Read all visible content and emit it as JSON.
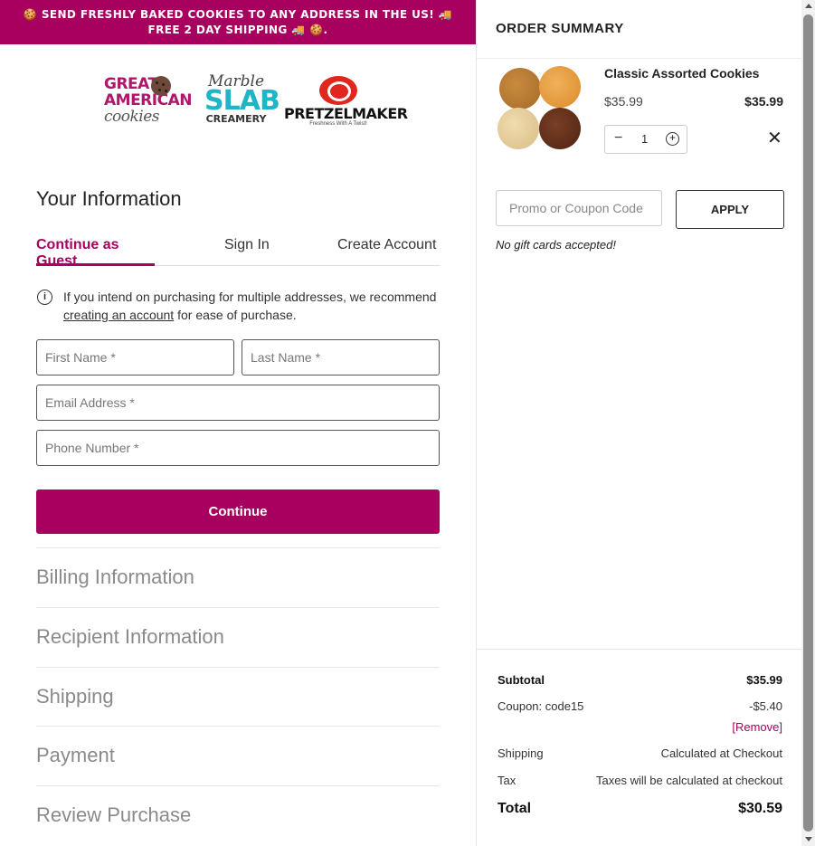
{
  "banner": {
    "text": "🍪 Send freshly baked cookies to any address in the US! 🚚 Free 2 day shipping 🚚 🍪."
  },
  "brands": {
    "gac": {
      "line1": "GREAT",
      "line2": "AMERICAN",
      "line3": "cookies"
    },
    "msc": {
      "line1": "Marble",
      "line2": "SLAB",
      "line3": "CREAMERY"
    },
    "pm": {
      "line1": "PRETZELMAKER",
      "tagline": "Freshness With A Twist!"
    }
  },
  "your_info": {
    "title": "Your Information",
    "tabs": [
      {
        "label": "Continue as Guest",
        "active": true
      },
      {
        "label": "Sign In",
        "active": false
      },
      {
        "label": "Create Account",
        "active": false
      }
    ],
    "note_before": "If you intend on purchasing for multiple addresses, we recommend ",
    "note_link": "creating an account",
    "note_after": " for ease of purchase.",
    "fields": {
      "first_name": {
        "placeholder": "First Name *",
        "value": ""
      },
      "last_name": {
        "placeholder": "Last Name *",
        "value": ""
      },
      "email": {
        "placeholder": "Email Address *",
        "value": ""
      },
      "phone": {
        "placeholder": "Phone Number *",
        "value": ""
      }
    },
    "continue_label": "Continue"
  },
  "sections": [
    "Billing Information",
    "Recipient Information",
    "Shipping",
    "Payment",
    "Review Purchase"
  ],
  "order_summary": {
    "title": "ORDER SUMMARY",
    "item": {
      "name": "Classic Assorted Cookies",
      "unit_price": "$35.99",
      "line_total": "$35.99",
      "quantity": "1"
    },
    "promo_placeholder": "Promo or Coupon Code",
    "apply_label": "APPLY",
    "gift_note": "No gift cards accepted!",
    "totals": {
      "subtotal_label": "Subtotal",
      "subtotal_value": "$35.99",
      "coupon_label": "Coupon: code15",
      "coupon_value": "-$5.40",
      "coupon_remove": "[Remove]",
      "shipping_label": "Shipping",
      "shipping_value": "Calculated at Checkout",
      "tax_label": "Tax",
      "tax_value": "Taxes will be calculated at checkout",
      "total_label": "Total",
      "total_value": "$30.59"
    }
  },
  "colors": {
    "brand": "#a8005f",
    "section_text": "#8a8a8a"
  }
}
